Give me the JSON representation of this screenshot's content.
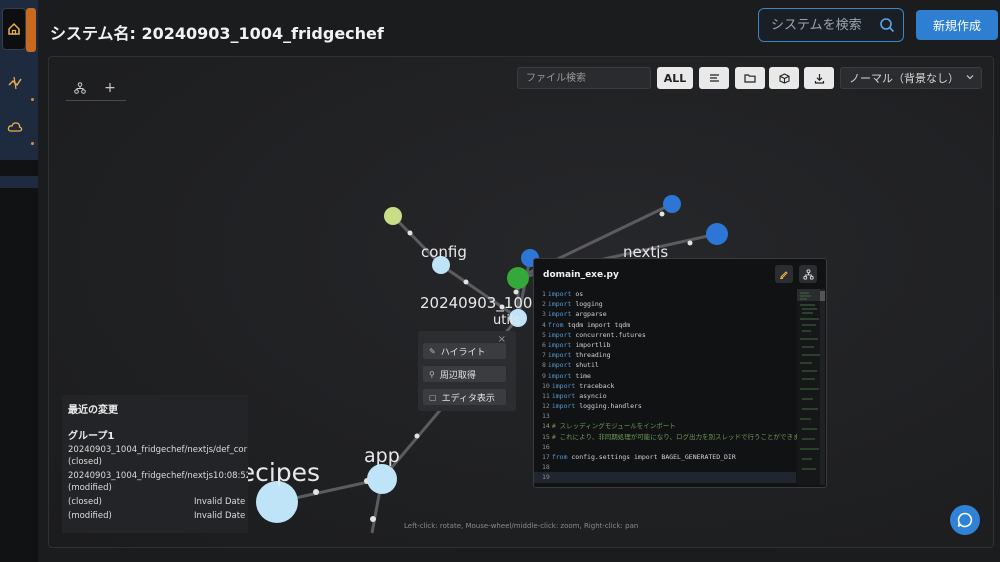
{
  "header": {
    "title": "システム名: 20240903_1004_fridgechef",
    "search_placeholder": "システムを検索",
    "new_button": "新規作成"
  },
  "sidebar": {
    "items": [
      {
        "icon": "home-icon"
      },
      {
        "icon": "flow-icon"
      },
      {
        "icon": "cloud-icon"
      }
    ]
  },
  "toolbar": {
    "file_search_placeholder": "ファイル検索",
    "all_button": "ALL",
    "mode": "ノーマル（背景なし）"
  },
  "tabs": [
    {
      "icon": "graph-icon"
    },
    {
      "label": "+"
    }
  ],
  "graph": {
    "labels": {
      "config": "config",
      "nextjs": "nextjs",
      "root": "20240903_1004",
      "utils": "utils",
      "app": "app",
      "recipes": "recipes"
    },
    "colors": {
      "node_light": "#bfe3f7",
      "node_blue": "#2e76d6",
      "node_green": "#35a83a",
      "node_yellow": "#c9dd86",
      "edge": "#5a5c60"
    }
  },
  "context_menu": {
    "close": "×",
    "items": [
      "ハイライト",
      "周辺取得",
      "エディタ表示"
    ]
  },
  "recent": {
    "title": "最近の変更",
    "group": "グループ1",
    "lines": [
      {
        "text": "20240903_1004_fridgechef/nextjs/def_cor",
        "date": ""
      },
      {
        "text": "(closed)",
        "date": ""
      },
      {
        "text": "20240903_1004_fridgechef/nextjs10:08:52",
        "date": ""
      },
      {
        "text": "(modified)",
        "date": ""
      },
      {
        "text": "(closed)",
        "date": "Invalid Date"
      },
      {
        "text": "(modified)",
        "date": "Invalid Date"
      }
    ]
  },
  "editor": {
    "filename": "domain_exe.py",
    "lines": [
      {
        "n": "1",
        "kw": "import",
        "rest": " os"
      },
      {
        "n": "2",
        "kw": "import",
        "rest": " logging"
      },
      {
        "n": "3",
        "kw": "import",
        "rest": " argparse"
      },
      {
        "n": "4",
        "kw": "from",
        "rest": " tqdm import tqdm"
      },
      {
        "n": "5",
        "kw": "import",
        "rest": " concurrent.futures"
      },
      {
        "n": "6",
        "kw": "import",
        "rest": " importlib"
      },
      {
        "n": "7",
        "kw": "import",
        "rest": " threading"
      },
      {
        "n": "8",
        "kw": "import",
        "rest": " shutil"
      },
      {
        "n": "9",
        "kw": "import",
        "rest": " time"
      },
      {
        "n": "10",
        "kw": "import",
        "rest": " traceback"
      },
      {
        "n": "11",
        "kw": "import",
        "rest": " asyncio"
      },
      {
        "n": "12",
        "kw": "import",
        "rest": " logging.handlers"
      },
      {
        "n": "13",
        "kw": "",
        "rest": ""
      },
      {
        "n": "14",
        "cm": "# スレッディングモジュールをインポート"
      },
      {
        "n": "15",
        "cm": "# これにより、非同期処理が可能になり、ログ出力を別スレッドで行うことができます"
      },
      {
        "n": "16",
        "kw": "",
        "rest": ""
      },
      {
        "n": "17",
        "kw": "from",
        "rest": " config.settings import BAGEL_GENERATED_DIR"
      },
      {
        "n": "18",
        "kw": "",
        "rest": ""
      },
      {
        "n": "19",
        "kw": "",
        "rest": ""
      }
    ]
  },
  "hint": "Left-click: rotate, Mouse-wheel/middle-click: zoom, Right-click: pan"
}
